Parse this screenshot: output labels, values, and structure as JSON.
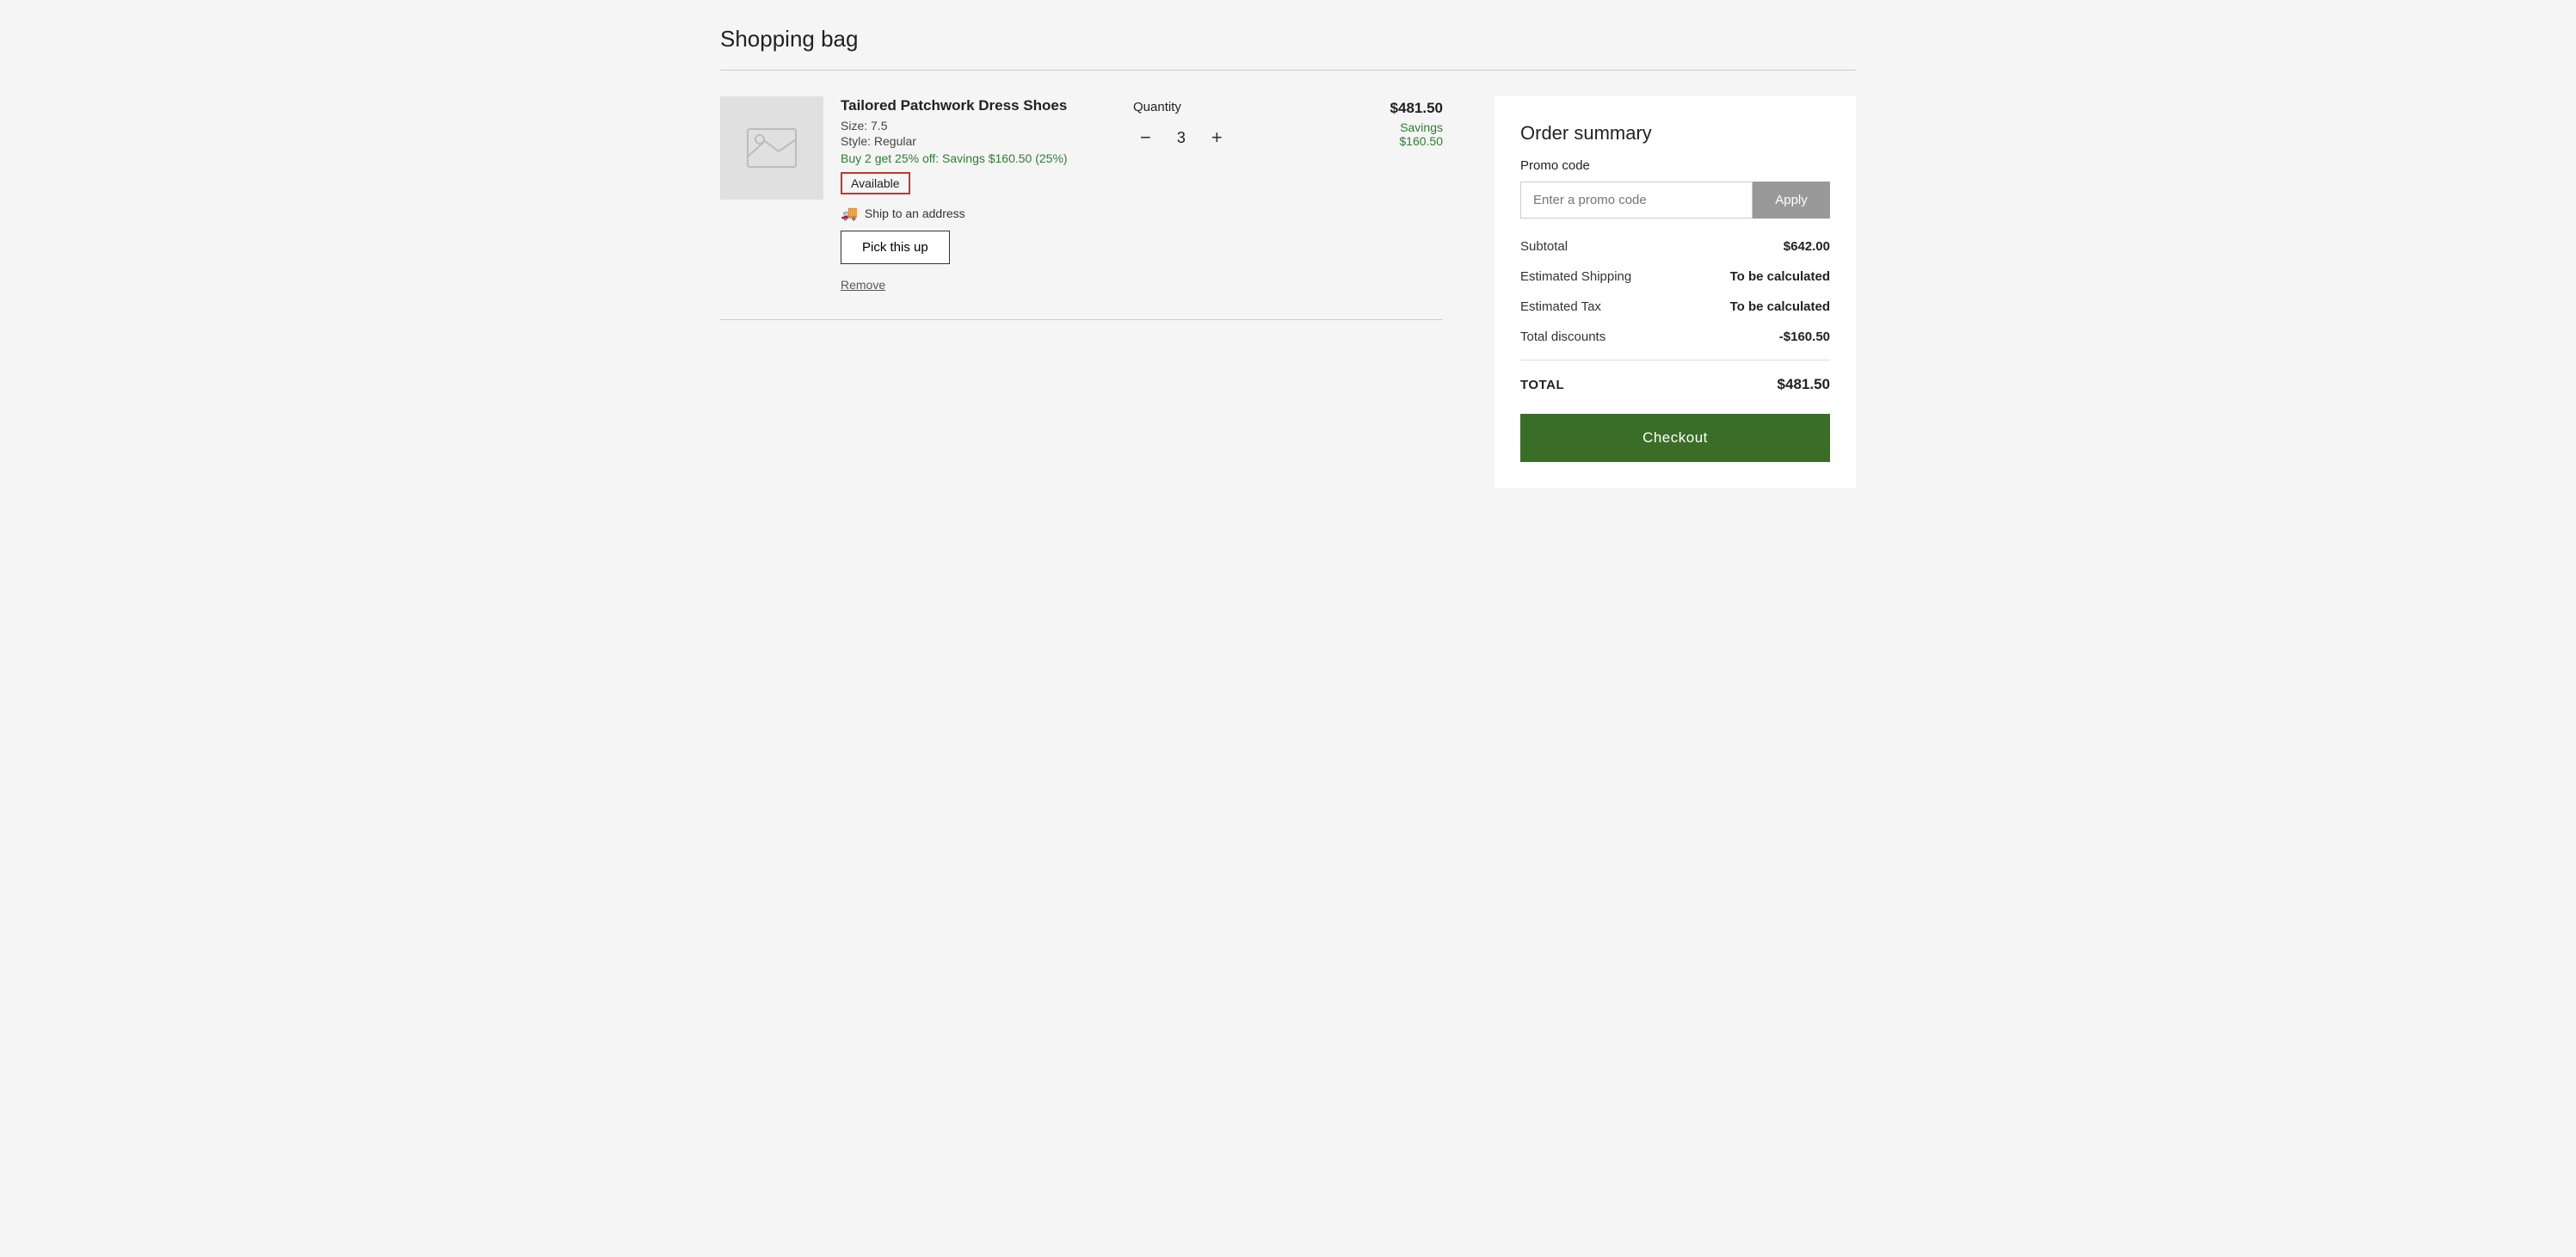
{
  "page": {
    "title": "Shopping bag"
  },
  "cart": {
    "item": {
      "name": "Tailored Patchwork Dress Shoes",
      "size": "Size: 7.5",
      "style": "Style: Regular",
      "promo_text": "Buy 2 get 25% off: Savings $160.50 (25%)",
      "availability": "Available",
      "ship_label": "Ship to an address",
      "pickup_label": "Pick this up",
      "remove_label": "Remove",
      "quantity_label": "Quantity",
      "quantity": "3",
      "price": "$481.50",
      "savings_label": "Savings",
      "savings_amount": "$160.50"
    }
  },
  "order_summary": {
    "title": "Order summary",
    "promo_label": "Promo code",
    "promo_placeholder": "Enter a promo code",
    "apply_label": "Apply",
    "subtotal_label": "Subtotal",
    "subtotal_value": "$642.00",
    "shipping_label": "Estimated Shipping",
    "shipping_value": "To be calculated",
    "tax_label": "Estimated Tax",
    "tax_value": "To be calculated",
    "discounts_label": "Total discounts",
    "discounts_value": "-$160.50",
    "total_label": "TOTAL",
    "total_value": "$481.50",
    "checkout_label": "Checkout"
  },
  "colors": {
    "green_button": "#3a6e28",
    "promo_apply": "#999999",
    "savings_green": "#2e7d32",
    "availability_border": "#c0392b"
  }
}
